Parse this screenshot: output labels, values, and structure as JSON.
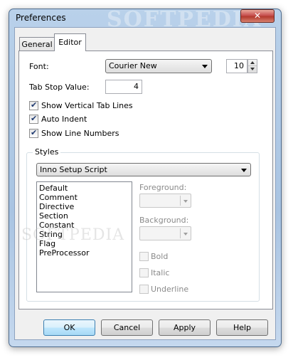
{
  "window": {
    "title": "Preferences",
    "watermark": "SOFTPEDIA",
    "close_glyph": "✕"
  },
  "tabs": [
    {
      "label": "General",
      "active": false
    },
    {
      "label": "Editor",
      "active": true
    }
  ],
  "editor": {
    "font_label": "Font:",
    "font_value": "Courier New",
    "font_size": "10",
    "tabstop_label": "Tab Stop Value:",
    "tabstop_value": "4",
    "checkboxes": [
      {
        "label": "Show Vertical Tab Lines",
        "checked": true
      },
      {
        "label": "Auto Indent",
        "checked": true
      },
      {
        "label": "Show Line Numbers",
        "checked": true
      }
    ]
  },
  "styles": {
    "group_title": "Styles",
    "scheme": "Inno Setup Script",
    "items": [
      "Default",
      "Comment",
      "Directive",
      "Section",
      "Constant",
      "String",
      "Flag",
      "PreProcessor"
    ],
    "foreground_label": "Foreground:",
    "background_label": "Background:",
    "options": [
      {
        "label": "Bold",
        "checked": false
      },
      {
        "label": "Italic",
        "checked": false
      },
      {
        "label": "Underline",
        "checked": false
      }
    ]
  },
  "buttons": {
    "ok": "OK",
    "cancel": "Cancel",
    "apply": "Apply",
    "help": "Help"
  },
  "colors": {
    "accent": "#3c7fb1",
    "titlebar": "#b9d1ea",
    "close": "#c75050"
  }
}
